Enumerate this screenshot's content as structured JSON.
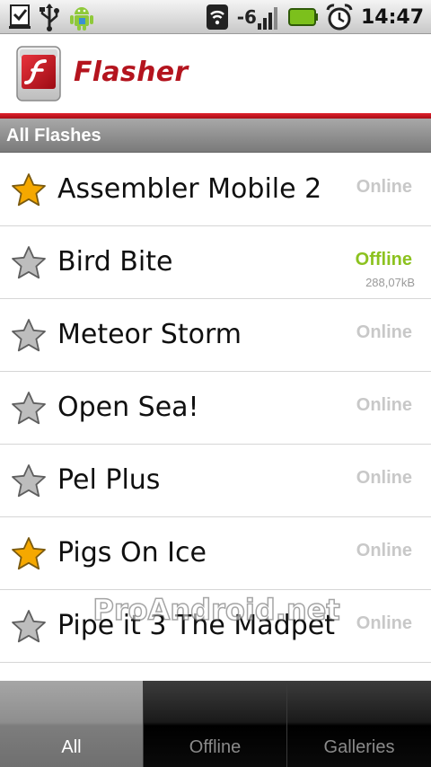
{
  "status_bar": {
    "signal_strength": "-6",
    "time": "14:47",
    "icons": [
      "download-complete-icon",
      "usb-icon",
      "android-icon",
      "wifi-icon",
      "signal-bars-icon",
      "battery-icon",
      "alarm-clock-icon"
    ]
  },
  "header": {
    "app_title": "Flasher",
    "app_icon": "flash-player-icon",
    "accent_color": "#c1131d"
  },
  "section": {
    "title": "All Flashes"
  },
  "list": {
    "items": [
      {
        "title": "Assembler Mobile 2",
        "status": "Online",
        "favorite": true
      },
      {
        "title": "Bird Bite",
        "status": "Offline",
        "size": "288,07kB",
        "favorite": false
      },
      {
        "title": "Meteor Storm",
        "status": "Online",
        "favorite": false
      },
      {
        "title": "Open Sea!",
        "status": "Online",
        "favorite": false
      },
      {
        "title": "Pel Plus",
        "status": "Online",
        "favorite": false
      },
      {
        "title": "Pigs On Ice",
        "status": "Online",
        "favorite": true
      },
      {
        "title": "Pipe it 3 The Madpet",
        "status": "Online",
        "favorite": false
      }
    ]
  },
  "watermark": "ProAndroid.net",
  "tabs": [
    {
      "label": "All",
      "active": true
    },
    {
      "label": "Offline",
      "active": false
    },
    {
      "label": "Galleries",
      "active": false
    }
  ],
  "colors": {
    "online_status": "#c8c8c8",
    "offline_status": "#8cc21f",
    "favorite_star": "#f5a800",
    "inactive_star": "#bdbdbd"
  }
}
